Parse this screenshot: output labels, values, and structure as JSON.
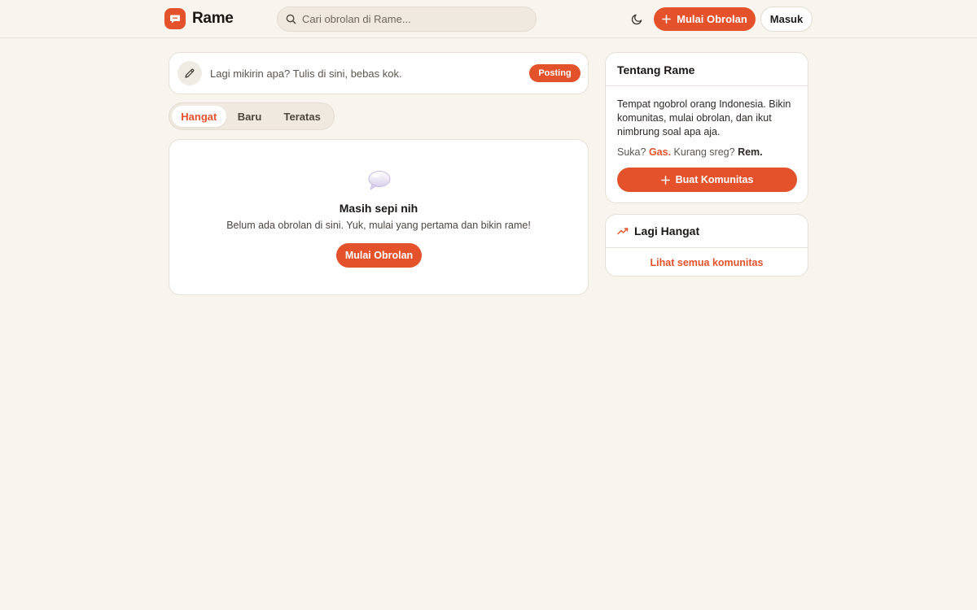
{
  "header": {
    "brand": "Rame",
    "search_placeholder": "Cari obrolan di Rame...",
    "new_chat_label": "Mulai Obrolan",
    "login_label": "Masuk"
  },
  "composer": {
    "prompt": "Lagi mikirin apa? Tulis di sini, bebas kok.",
    "post_label": "Posting"
  },
  "tabs": [
    {
      "label": "Hangat",
      "active": true
    },
    {
      "label": "Baru",
      "active": false
    },
    {
      "label": "Teratas",
      "active": false
    }
  ],
  "empty_state": {
    "title": "Masih sepi nih",
    "description": "Belum ada obrolan di sini. Yuk, mulai yang pertama dan bikin rame!",
    "button_label": "Mulai Obrolan"
  },
  "about": {
    "title": "Tentang Rame",
    "description": "Tempat ngobrol orang Indonesia. Bikin komunitas, mulai obrolan, dan ikut nimbrung soal apa aja.",
    "tagline_prefix": "Suka?",
    "tagline_gas": "Gas.",
    "tagline_middle": "Kurang sreg?",
    "tagline_rem": "Rem.",
    "button_label": "Buat Komunitas"
  },
  "trending": {
    "title": "Lagi Hangat",
    "link_label": "Lihat semua komunitas"
  },
  "colors": {
    "accent": "#e4522b",
    "background": "#f8f5ef"
  }
}
